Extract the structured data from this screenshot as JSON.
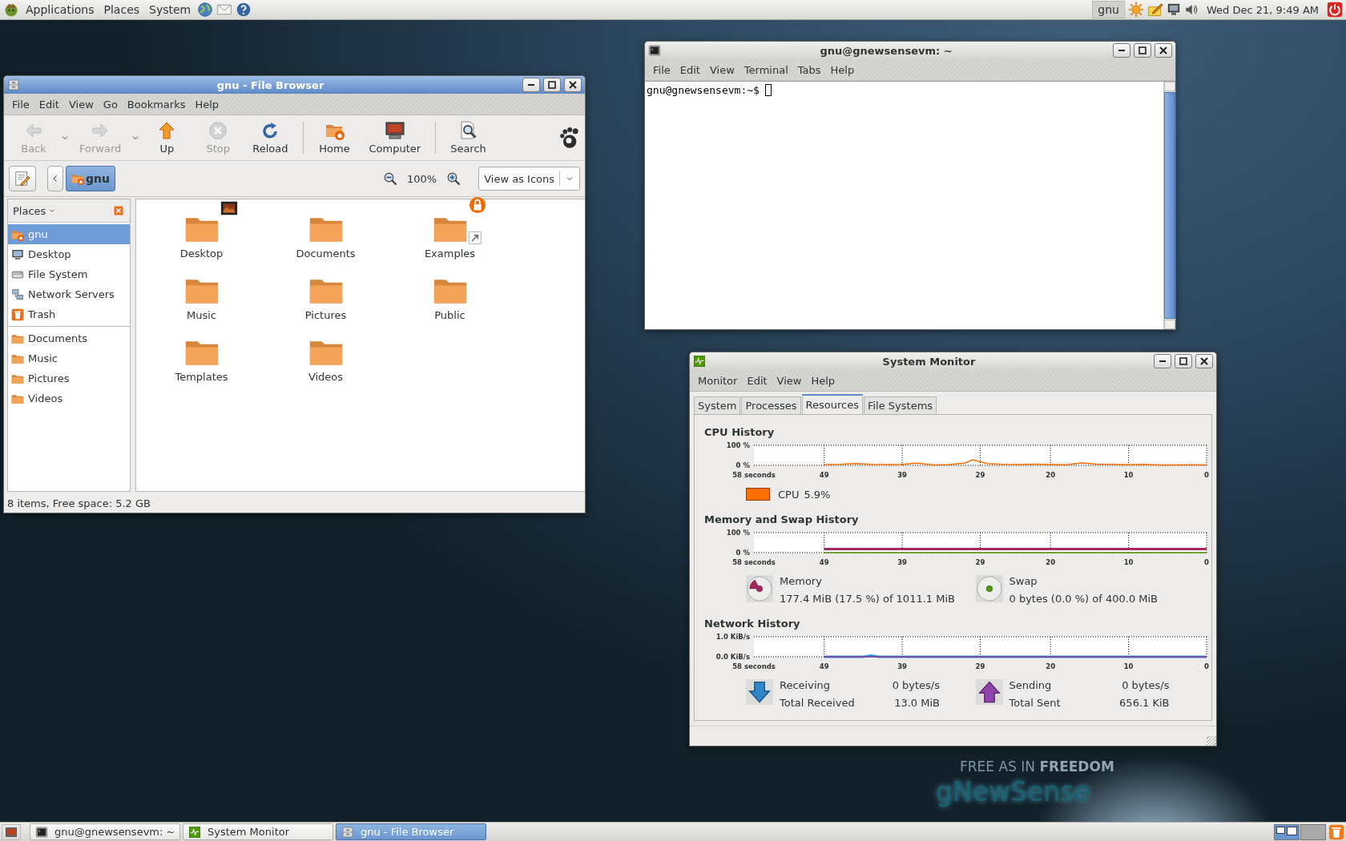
{
  "top_panel": {
    "menus": [
      "Applications",
      "Places",
      "System"
    ],
    "user": "gnu",
    "clock": "Wed Dec 21, 9:49 AM"
  },
  "file_browser": {
    "title": "gnu - File Browser",
    "focused": true,
    "menus": [
      "File",
      "Edit",
      "View",
      "Go",
      "Bookmarks",
      "Help"
    ],
    "toolbar": [
      {
        "kind": "back",
        "label": "Back",
        "disabled": true,
        "dropdown": true
      },
      {
        "kind": "forward",
        "label": "Forward",
        "disabled": true,
        "dropdown": true
      },
      {
        "kind": "up",
        "label": "Up",
        "disabled": false
      },
      {
        "kind": "stop",
        "label": "Stop",
        "disabled": true
      },
      {
        "kind": "reload",
        "label": "Reload",
        "disabled": false
      },
      {
        "kind": "home",
        "label": "Home",
        "disabled": false,
        "separator_before": true
      },
      {
        "kind": "computer",
        "label": "Computer",
        "disabled": false
      },
      {
        "kind": "search",
        "label": "Search",
        "disabled": false,
        "separator_before": true
      }
    ],
    "location": {
      "path": [
        {
          "label": "gnu",
          "selected": true
        }
      ],
      "zoom": "100%",
      "view": "View as Icons"
    },
    "sidebar": {
      "header": "Places",
      "items": [
        {
          "kind": "home",
          "label": "gnu",
          "selected": true
        },
        {
          "kind": "desktop",
          "label": "Desktop",
          "selected": false
        },
        {
          "kind": "drive",
          "label": "File System",
          "selected": false
        },
        {
          "kind": "network",
          "label": "Network Servers",
          "selected": false
        },
        {
          "kind": "trash",
          "label": "Trash",
          "selected": false
        },
        {
          "kind": "folder",
          "label": "Documents",
          "selected": false,
          "separator_before": true
        },
        {
          "kind": "folder",
          "label": "Music",
          "selected": false
        },
        {
          "kind": "folder",
          "label": "Pictures",
          "selected": false
        },
        {
          "kind": "folder",
          "label": "Videos",
          "selected": false
        }
      ]
    },
    "files": [
      {
        "label": "Desktop",
        "kind": "picture-emblem"
      },
      {
        "label": "Documents",
        "kind": "plain"
      },
      {
        "label": "Examples",
        "kind": "lock-link-emblem"
      },
      {
        "label": "Music",
        "kind": "plain"
      },
      {
        "label": "Pictures",
        "kind": "plain"
      },
      {
        "label": "Public",
        "kind": "plain"
      },
      {
        "label": "Templates",
        "kind": "plain"
      },
      {
        "label": "Videos",
        "kind": "plain"
      }
    ],
    "status": "8 items, Free space: 5.2 GB"
  },
  "terminal": {
    "title": "gnu@gnewsensevm: ~",
    "focused": false,
    "menus": [
      "File",
      "Edit",
      "View",
      "Terminal",
      "Tabs",
      "Help"
    ],
    "prompt": "gnu@gnewsensevm:~$"
  },
  "monitor": {
    "title": "System Monitor",
    "focused": false,
    "menus": [
      "Monitor",
      "Edit",
      "View",
      "Help"
    ],
    "tabs": [
      {
        "label": "System",
        "selected": false
      },
      {
        "label": "Processes",
        "selected": false
      },
      {
        "label": "Resources",
        "selected": true
      },
      {
        "label": "File Systems",
        "selected": false
      }
    ],
    "sections": [
      {
        "kind": "cpu",
        "title": "CPU History",
        "chart_data": {
          "type": "line",
          "grid": true,
          "x": [
            49,
            47,
            45,
            43,
            41,
            39,
            37,
            35,
            33,
            31,
            30,
            28,
            26,
            24,
            22,
            20,
            18,
            16,
            14,
            12,
            10,
            8,
            6,
            4,
            2,
            0
          ],
          "xlim": [
            58,
            0
          ],
          "ylim": [
            0,
            100
          ],
          "xlabel": "58 seconds",
          "xticks": [
            49,
            39,
            29,
            20,
            10,
            0
          ],
          "yticks": [
            {
              "value": 100,
              "label": "100 %"
            },
            {
              "value": 0,
              "label": "0 %"
            }
          ],
          "series": [
            {
              "name": "CPU",
              "color": "#ff6e00",
              "values": [
                4,
                5,
                9,
                5,
                4,
                5,
                11,
                2,
                4,
                11,
                28,
                8,
                5,
                4,
                6,
                4,
                3,
                12,
                6,
                5,
                3,
                5,
                2,
                2,
                3,
                2
              ]
            }
          ]
        },
        "legend": [
          {
            "value": "5.9%"
          }
        ]
      },
      {
        "kind": "memory",
        "title": "Memory and Swap History",
        "chart_data": {
          "type": "line",
          "grid": true,
          "x": [
            49,
            0
          ],
          "xlim": [
            58,
            0
          ],
          "ylim": [
            0,
            100
          ],
          "xlabel": "58 seconds",
          "xticks": [
            49,
            39,
            29,
            20,
            10,
            0
          ],
          "yticks": [
            {
              "value": 100,
              "label": "100 %"
            },
            {
              "value": 0,
              "label": "0 %"
            }
          ],
          "series": [
            {
              "name": "Memory",
              "color": "#a8245e",
              "values": [
                18,
                18
              ]
            },
            {
              "name": "Swap",
              "color": "#4e9a06",
              "values": [
                0,
                0
              ]
            }
          ]
        },
        "legend": [
          {
            "value": "177.4 MiB (17.5 %) of 1011.1 MiB",
            "level": 0.175
          },
          {
            "value": "0 bytes (0.0 %) of 400.0 MiB"
          }
        ]
      },
      {
        "kind": "network",
        "title": "Network History",
        "chart_data": {
          "type": "line",
          "grid": true,
          "x": [
            49,
            44,
            43,
            42,
            0
          ],
          "xlim": [
            58,
            0
          ],
          "ylim": [
            0,
            1
          ],
          "xlabel": "58 seconds",
          "xticks": [
            49,
            39,
            29,
            20,
            10,
            0
          ],
          "yticks": [
            {
              "value": 1,
              "label": "1.0 KiB/s"
            },
            {
              "value": 0,
              "label": "0.0 KiB/s"
            }
          ],
          "series": [
            {
              "name": "Receiving",
              "color": "#3d8fd6",
              "values": [
                0,
                0,
                0.06,
                0,
                0
              ]
            },
            {
              "name": "Sending",
              "color": "#7b3f9a",
              "values": [
                0,
                0,
                0,
                0,
                0
              ]
            }
          ]
        },
        "legend": [
          {
            "value": "0 bytes/s",
            "total_label": "Total Received",
            "total": "13.0 MiB"
          },
          {
            "value": "0 bytes/s",
            "total_label": "Total Sent",
            "total": "656.1 KiB"
          }
        ]
      }
    ]
  },
  "branding": {
    "tagline": "FREE AS IN **FREEDOM**",
    "logo": "gNewSense"
  },
  "taskbar": {
    "tasks": [
      {
        "kind": "terminal",
        "label": "gnu@gnewsensevm: ~",
        "selected": false
      },
      {
        "kind": "monitor",
        "label": "System Monitor",
        "selected": false
      },
      {
        "kind": "cabinet",
        "label": "gnu - File Browser",
        "selected": true
      }
    ],
    "workspaces": [
      {
        "selected": true
      },
      {
        "selected": false
      }
    ]
  }
}
